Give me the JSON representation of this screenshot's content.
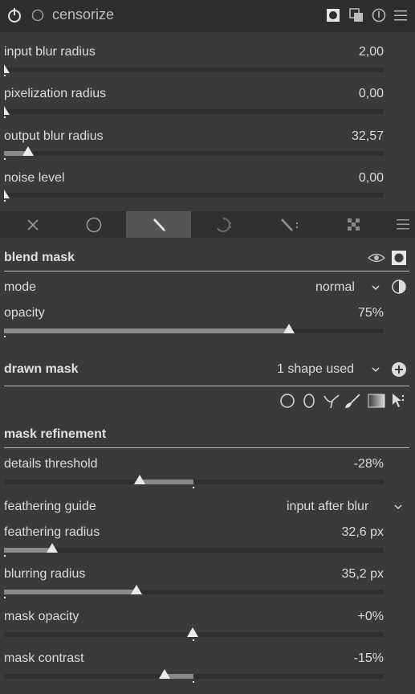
{
  "module": {
    "title": "censorize"
  },
  "sliders": [
    {
      "label": "input blur radius",
      "value": "2,00",
      "fraction": 0.0
    },
    {
      "label": "pixelization radius",
      "value": "0,00",
      "fraction": 0.0
    },
    {
      "label": "output blur radius",
      "value": "32,57",
      "fraction": 0.065
    },
    {
      "label": "noise level",
      "value": "0,00",
      "fraction": 0.0
    }
  ],
  "tabs": [
    {
      "name": "off",
      "glyph": "✕"
    },
    {
      "name": "uniformly",
      "glyph": "○"
    },
    {
      "name": "drawn-mask",
      "glyph": "✎"
    },
    {
      "name": "parametric-mask",
      "glyph": "◌"
    },
    {
      "name": "drawn-parametric",
      "glyph": "✎"
    },
    {
      "name": "raster-mask",
      "glyph": "▦"
    }
  ],
  "blend_mask": {
    "title": "blend mask",
    "mode_label": "mode",
    "mode_value": "normal",
    "opacity_label": "opacity",
    "opacity_value": "75%",
    "opacity_fraction": 0.75
  },
  "drawn_mask": {
    "title": "drawn mask",
    "shapes_used": "1 shape used"
  },
  "refinement": {
    "title": "mask refinement",
    "details_threshold": {
      "label": "details threshold",
      "value": "-28%",
      "fraction": -0.28
    },
    "feathering_guide": {
      "label": "feathering guide",
      "value": "input after blur"
    },
    "feathering_radius": {
      "label": "feathering radius",
      "value": "32,6 px",
      "fraction": 0.13
    },
    "blurring_radius": {
      "label": "blurring radius",
      "value": "35,2 px",
      "fraction": 0.35
    },
    "mask_opacity": {
      "label": "mask opacity",
      "value": "+0%",
      "fraction": 0.0
    },
    "mask_contrast": {
      "label": "mask contrast",
      "value": "-15%",
      "fraction": -0.15
    }
  }
}
